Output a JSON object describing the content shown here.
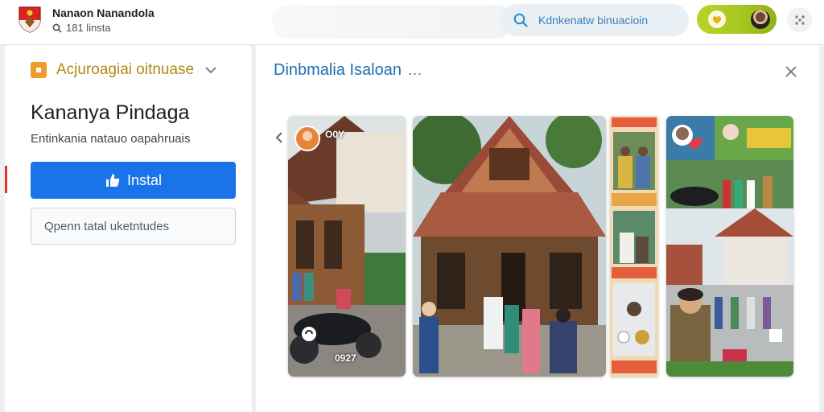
{
  "header": {
    "app_name": "Nanaon Nanandola",
    "app_subtitle": "181 linsta",
    "search_placeholder": "Kdnkenatw binuacioin",
    "search_icon": "search-icon",
    "heart_icon": "heart-icon",
    "more_icon": "grid-dots-icon"
  },
  "sidebar": {
    "category_label": "Acjuroagiai oitnuase",
    "title": "Kananya Pindaga",
    "description": "Entinkania natauo oapahruais",
    "install_label": "Instal",
    "secondary_field_text": "Qpenn tatal uketntudes"
  },
  "gallery": {
    "title": "Dinbmalia Isaloan",
    "more_label": "...",
    "shot1_badge_text": "O0Y",
    "shot1_caption": "0927"
  },
  "colors": {
    "accent_blue": "#1a73e8",
    "title_blue": "#1f6fb0",
    "category_gold": "#b48a12",
    "category_orange": "#f19a2a",
    "pill_green": "#a7c61f",
    "logo_red": "#d8261c"
  }
}
